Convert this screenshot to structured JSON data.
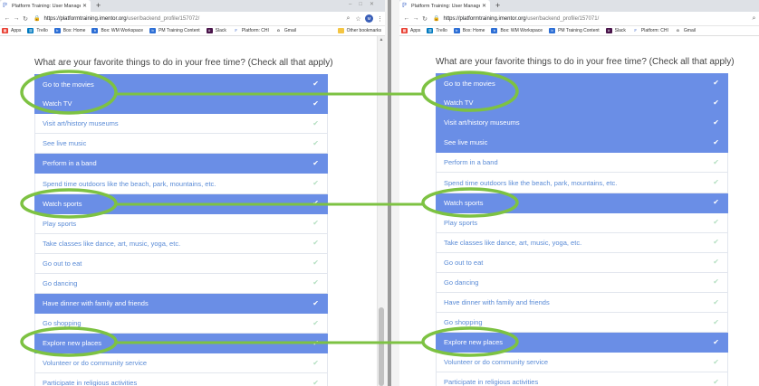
{
  "colors": {
    "accent": "#6a8ee6",
    "annotation": "#7dc242",
    "check_unselected": "#b6e0c3",
    "link_text": "#5a8bd6"
  },
  "left": {
    "tab_title": "Platform Training: User Manage",
    "tab_icon": "platform-logo-icon",
    "url_host": "https://platformtraining.imentor.org",
    "url_path": "/user/backend_profile/157072/",
    "avatar": "M",
    "bookmarks": [
      "Apps",
      "Trello",
      "Box: Home",
      "Box: WM Workspace",
      "PM Training Content",
      "Slack",
      "Platform: CHI",
      "Gmail"
    ],
    "other_bookmarks": "Other bookmarks",
    "question": "What are your favorite things to do in your free time? (Check all that apply)",
    "options": [
      {
        "label": "Go to the movies",
        "checked": true
      },
      {
        "label": "Watch TV",
        "checked": true
      },
      {
        "label": "Visit art/history museums",
        "checked": false
      },
      {
        "label": "See live music",
        "checked": false
      },
      {
        "label": "Perform in a band",
        "checked": true
      },
      {
        "label": "Spend time outdoors like the beach, park, mountains, etc.",
        "checked": false
      },
      {
        "label": "Watch sports",
        "checked": true
      },
      {
        "label": "Play sports",
        "checked": false
      },
      {
        "label": "Take classes like dance, art, music, yoga, etc.",
        "checked": false
      },
      {
        "label": "Go out to eat",
        "checked": false
      },
      {
        "label": "Go dancing",
        "checked": false
      },
      {
        "label": "Have dinner with family and friends",
        "checked": true
      },
      {
        "label": "Go shopping",
        "checked": false
      },
      {
        "label": "Explore new places",
        "checked": true
      },
      {
        "label": "Volunteer or do community service",
        "checked": false
      },
      {
        "label": "Participate in religious activities",
        "checked": false
      }
    ]
  },
  "right": {
    "tab_title": "Platform Training: User Manage",
    "tab_icon": "platform-logo-icon",
    "url_host": "https://platformtraining.imentor.org",
    "url_path": "/user/backend_profile/157071/",
    "bookmarks": [
      "Apps",
      "Trello",
      "Box: Home",
      "Box: WM Workspace",
      "PM Training Content",
      "Slack",
      "Platform: CHI",
      "Gmail"
    ],
    "question": "What are your favorite things to do in your free time? (Check all that apply)",
    "options": [
      {
        "label": "Go to the movies",
        "checked": true
      },
      {
        "label": "Watch TV",
        "checked": true
      },
      {
        "label": "Visit art/history museums",
        "checked": true
      },
      {
        "label": "See live music",
        "checked": true
      },
      {
        "label": "Perform in a band",
        "checked": false
      },
      {
        "label": "Spend time outdoors like the beach, park, mountains, etc.",
        "checked": false
      },
      {
        "label": "Watch sports",
        "checked": true
      },
      {
        "label": "Play sports",
        "checked": false
      },
      {
        "label": "Take classes like dance, art, music, yoga, etc.",
        "checked": false
      },
      {
        "label": "Go out to eat",
        "checked": false
      },
      {
        "label": "Go dancing",
        "checked": false
      },
      {
        "label": "Have dinner with family and friends",
        "checked": false
      },
      {
        "label": "Go shopping",
        "checked": false
      },
      {
        "label": "Explore new places",
        "checked": true
      },
      {
        "label": "Volunteer or do community service",
        "checked": false
      },
      {
        "label": "Participate in religious activities",
        "checked": false
      }
    ]
  },
  "annotation_matches": [
    "Go to the movies",
    "Watch TV",
    "Watch sports",
    "Explore new places"
  ]
}
